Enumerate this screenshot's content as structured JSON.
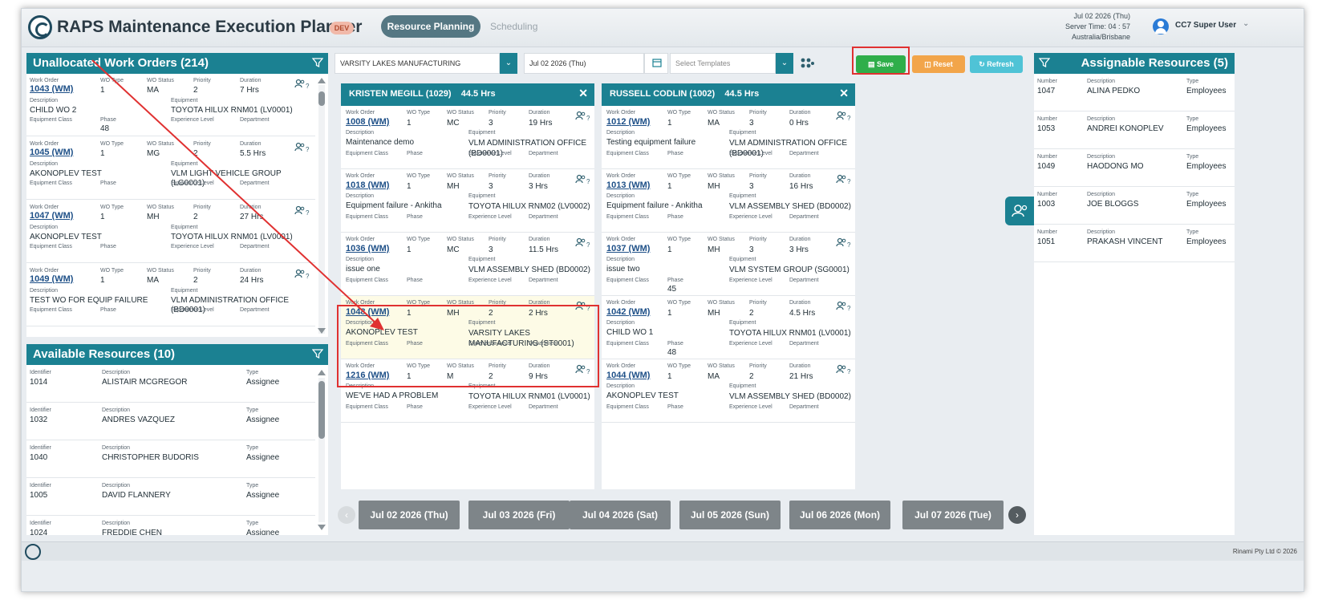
{
  "header": {
    "app_title": "RAPS Maintenance Execution Planner",
    "env_badge": "DEV",
    "tabs": [
      {
        "label": "Resource Planning",
        "active": true
      },
      {
        "label": "Scheduling",
        "active": false
      }
    ],
    "server_date": "Jul 02 2026 (Thu)",
    "server_time": "Server Time: 04 : 57",
    "timezone": "Australia/Brisbane",
    "user_name": "CC7 Super User"
  },
  "labels": {
    "work_order": "Work Order",
    "wo_type": "WO Type",
    "wo_status": "WO Status",
    "priority": "Priority",
    "duration": "Duration",
    "description": "Description",
    "equipment": "Equipment",
    "equipment_class": "Equipment Class",
    "phase": "Phase",
    "experience_level": "Experience Level",
    "department": "Department",
    "identifier": "Identifier",
    "type": "Type",
    "number": "Number",
    "assign_mark": "?"
  },
  "unallocated": {
    "title": "Unallocated Work Orders (214)",
    "cards": [
      {
        "wo": "1043 (WM)",
        "wo_type": "1",
        "status": "MA",
        "priority": "2",
        "duration": "7 Hrs",
        "desc": "CHILD WO 2",
        "equipment": "TOYOTA HILUX RNM01 (LV0001)",
        "phase": "48"
      },
      {
        "wo": "1045 (WM)",
        "wo_type": "1",
        "status": "MG",
        "priority": "2",
        "duration": "5.5 Hrs",
        "desc": "AKONOPLEV TEST",
        "equipment": "VLM LIGHT VEHICLE GROUP (LG0001)",
        "phase": ""
      },
      {
        "wo": "1047 (WM)",
        "wo_type": "1",
        "status": "MH",
        "priority": "2",
        "duration": "27 Hrs",
        "desc": "AKONOPLEV TEST",
        "equipment": "TOYOTA HILUX RNM01 (LV0001)",
        "phase": ""
      },
      {
        "wo": "1049 (WM)",
        "wo_type": "1",
        "status": "MA",
        "priority": "2",
        "duration": "24 Hrs",
        "desc": "TEST WO FOR EQUIP FAILURE",
        "equipment": "VLM ADMINISTRATION OFFICE (BD0001)",
        "phase": ""
      }
    ]
  },
  "available": {
    "title": "Available Resources (10)",
    "rows": [
      {
        "id": "1014",
        "desc": "ALISTAIR MCGREGOR",
        "type": "Assignee"
      },
      {
        "id": "1032",
        "desc": "ANDRES VAZQUEZ",
        "type": "Assignee"
      },
      {
        "id": "1040",
        "desc": "CHRISTOPHER BUDORIS",
        "type": "Assignee"
      },
      {
        "id": "1005",
        "desc": "DAVID FLANNERY",
        "type": "Assignee"
      },
      {
        "id": "1024",
        "desc": "FREDDIE CHEN",
        "type": "Assignee"
      }
    ]
  },
  "toolbar": {
    "site": "VARSITY LAKES MANUFACTURING",
    "date": "Jul 02 2026 (Thu)",
    "template_placeholder": "Select Templates",
    "save": "Save",
    "reset": "Reset",
    "refresh": "Refresh"
  },
  "columns": [
    {
      "title": "KRISTEN MEGILL (1029)    44.5 Hrs",
      "cards": [
        {
          "wo": "1008 (WM)",
          "wo_type": "1",
          "status": "MC",
          "priority": "3",
          "duration": "19 Hrs",
          "desc": "Maintenance demo",
          "equipment": "VLM ADMINISTRATION OFFICE (BD0001)",
          "phase": "",
          "highlight": false
        },
        {
          "wo": "1018 (WM)",
          "wo_type": "1",
          "status": "MH",
          "priority": "3",
          "duration": "3 Hrs",
          "desc": "Equipment failure - Ankitha",
          "equipment": "TOYOTA HILUX RNM02 (LV0002)",
          "phase": "",
          "highlight": false
        },
        {
          "wo": "1036 (WM)",
          "wo_type": "1",
          "status": "MC",
          "priority": "3",
          "duration": "11.5 Hrs",
          "desc": "issue one",
          "equipment": "VLM ASSEMBLY SHED (BD0002)",
          "phase": "",
          "highlight": false
        },
        {
          "wo": "1048 (WM)",
          "wo_type": "1",
          "status": "MH",
          "priority": "2",
          "duration": "2 Hrs",
          "desc": "AKONOPLEV TEST",
          "equipment": "VARSITY LAKES MANUFACTURING (ST0001)",
          "phase": "",
          "highlight": true
        },
        {
          "wo": "1216 (WM)",
          "wo_type": "1",
          "status": "M",
          "priority": "2",
          "duration": "9 Hrs",
          "desc": "WE'VE HAD A PROBLEM",
          "equipment": "TOYOTA HILUX RNM01 (LV0001)",
          "phase": "",
          "highlight": false
        }
      ]
    },
    {
      "title": "RUSSELL CODLIN (1002)    44.5 Hrs",
      "cards": [
        {
          "wo": "1012 (WM)",
          "wo_type": "1",
          "status": "MA",
          "priority": "3",
          "duration": "0 Hrs",
          "desc": "Testing equipment failure",
          "equipment": "VLM ADMINISTRATION OFFICE (BD0001)",
          "phase": "",
          "highlight": false
        },
        {
          "wo": "1013 (WM)",
          "wo_type": "1",
          "status": "MH",
          "priority": "3",
          "duration": "16 Hrs",
          "desc": "Equipment failure - Ankitha",
          "equipment": "VLM ASSEMBLY SHED (BD0002)",
          "phase": "",
          "highlight": false
        },
        {
          "wo": "1037 (WM)",
          "wo_type": "1",
          "status": "MH",
          "priority": "3",
          "duration": "3 Hrs",
          "desc": "issue two",
          "equipment": "VLM SYSTEM GROUP (SG0001)",
          "phase": "45",
          "highlight": false
        },
        {
          "wo": "1042 (WM)",
          "wo_type": "1",
          "status": "MH",
          "priority": "2",
          "duration": "4.5 Hrs",
          "desc": "CHILD WO 1",
          "equipment": "TOYOTA HILUX RNM01 (LV0001)",
          "phase": "48",
          "highlight": false
        },
        {
          "wo": "1044 (WM)",
          "wo_type": "1",
          "status": "MA",
          "priority": "2",
          "duration": "21 Hrs",
          "desc": "AKONOPLEV TEST",
          "equipment": "VLM ASSEMBLY SHED (BD0002)",
          "phase": "",
          "highlight": false
        }
      ]
    }
  ],
  "assignable": {
    "title": "Assignable Resources (5)",
    "rows": [
      {
        "num": "1047",
        "desc": "ALINA PEDKO",
        "type": "Employees"
      },
      {
        "num": "1053",
        "desc": "ANDREI KONOPLEV",
        "type": "Employees"
      },
      {
        "num": "1049",
        "desc": "HAODONG MO",
        "type": "Employees"
      },
      {
        "num": "1003",
        "desc": "JOE BLOGGS",
        "type": "Employees"
      },
      {
        "num": "1051",
        "desc": "PRAKASH VINCENT",
        "type": "Employees"
      }
    ]
  },
  "dates": [
    "Jul 02 2026 (Thu)",
    "Jul 03 2026 (Fri)",
    "Jul 04 2026 (Sat)",
    "Jul 05 2026 (Sun)",
    "Jul 06 2026 (Mon)",
    "Jul 07 2026 (Tue)"
  ],
  "footer": {
    "copyright": "Rinami Pty Ltd © 2026"
  },
  "icons": {
    "filter": "filter-icon",
    "assign": "assign-resource-icon",
    "group": "resource-group-icon",
    "calendar": "calendar-icon"
  },
  "colors": {
    "teal": "#1b8192",
    "save": "#2fae4a",
    "reset": "#f2a54a",
    "refresh": "#4fc3d6",
    "highlight": "#e03131"
  }
}
